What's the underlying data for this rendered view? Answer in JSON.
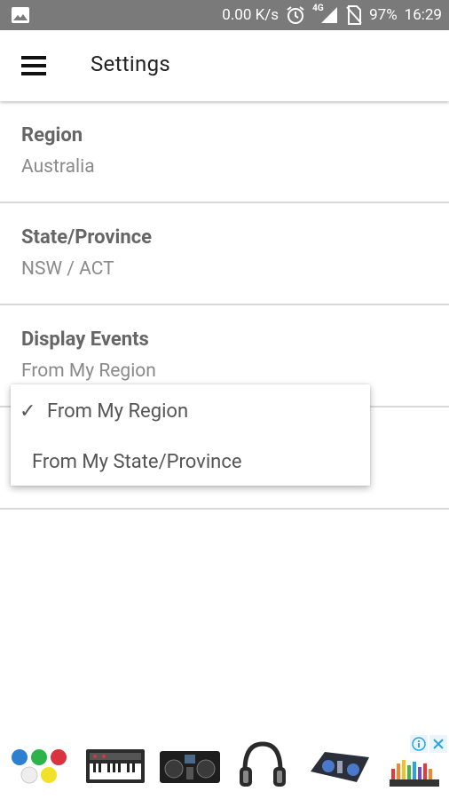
{
  "status_bar": {
    "speed": "0.00 K/s",
    "network": "4G",
    "battery": "97%",
    "time": "16:29",
    "icons": [
      "image-icon",
      "alarm-icon",
      "signal-icon",
      "no-sim-icon"
    ]
  },
  "app_bar": {
    "title": "Settings",
    "menu_icon": "hamburger-menu-icon"
  },
  "preferences": [
    {
      "title": "Region",
      "value": "Australia"
    },
    {
      "title": "State/Province",
      "value": "NSW / ACT"
    },
    {
      "title": "Display Events",
      "value": "From My Region"
    }
  ],
  "dropdown": {
    "options": [
      {
        "label": "From My Region",
        "checked": true,
        "check_glyph": "✓"
      },
      {
        "label": "From My State/Province",
        "checked": false
      }
    ]
  },
  "ad_banner": {
    "tiles": [
      "color-buttons-product",
      "midi-keyboard-product",
      "dj-controller-product",
      "headphones-product",
      "dj-mixer-product",
      "music-store-logo"
    ],
    "badges": [
      "adchoices-info-icon",
      "ad-close-icon"
    ],
    "colors": {
      "info": "#2aa4df",
      "close": "#2aa4df"
    }
  }
}
